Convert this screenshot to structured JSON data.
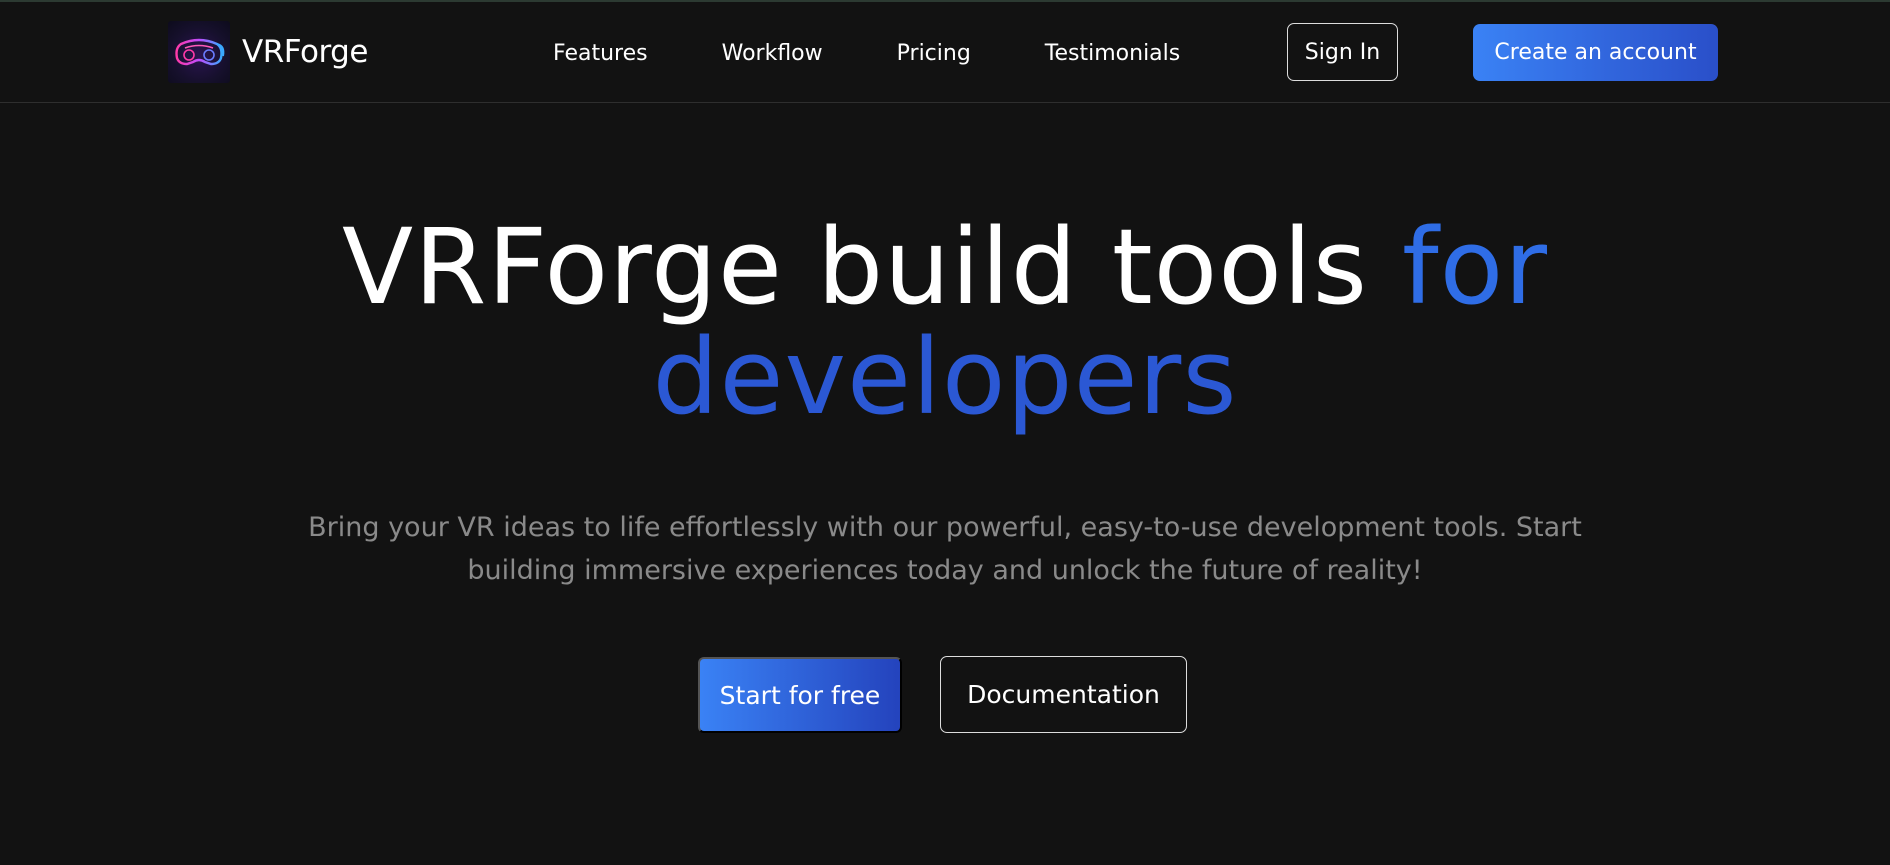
{
  "brand": {
    "name": "VRForge",
    "logo_icon": "vr-headset-icon"
  },
  "nav": {
    "links": [
      "Features",
      "Workflow",
      "Pricing",
      "Testimonials"
    ],
    "sign_in": "Sign In",
    "create_account": "Create an account"
  },
  "hero": {
    "title_part1": "VRForge build tools ",
    "title_part2": "for",
    "title_part3": "developers",
    "subtitle": "Bring your VR ideas to life effortlessly with our powerful, easy-to-use development tools. Start building immersive experiences today and unlock the future of reality!",
    "primary_cta": "Start for free",
    "secondary_cta": "Documentation"
  },
  "colors": {
    "background": "#121212",
    "accent": "#2f6de6",
    "button_gradient_start": "#3a82f5",
    "button_gradient_end": "#2a4fc9",
    "subtitle_text": "#8a8a8a"
  }
}
